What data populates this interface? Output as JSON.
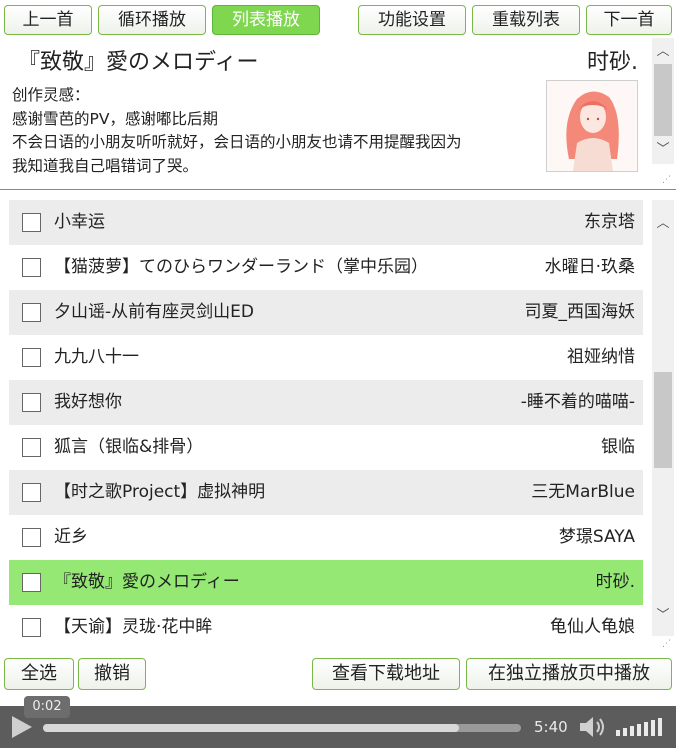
{
  "toolbar": {
    "prev": "上一首",
    "loop": "循环播放",
    "list_play": "列表播放",
    "settings": "功能设置",
    "reload": "重载列表",
    "next": "下一首"
  },
  "now_playing": {
    "title": "『致敬』愛のメロディー",
    "artist": "时砂.",
    "description": [
      "创作灵感：",
      "感谢雪芭的PV，感谢嘟比后期",
      "不会日语的小朋友听听就好，会日语的小朋友也请不用提醒我因为",
      "我知道我自己唱错词了哭。"
    ]
  },
  "playlist": [
    {
      "title": "小幸运",
      "artist": "东京塔"
    },
    {
      "title": "【猫菠萝】てのひらワンダーランド（掌中乐园）",
      "artist": "水曜日·玖桑"
    },
    {
      "title": "夕山谣-从前有座灵剑山ED",
      "artist": "司夏_西国海妖"
    },
    {
      "title": "九九八十一",
      "artist": "祖娅纳惜"
    },
    {
      "title": "我好想你",
      "artist": "-睡不着的喵喵-"
    },
    {
      "title": "狐言（银临&排骨）",
      "artist": "银临"
    },
    {
      "title": "【时之歌Project】虚拟神明",
      "artist": "三无MarBlue"
    },
    {
      "title": "近乡",
      "artist": "梦璟SAYA"
    },
    {
      "title": "『致敬』愛のメロディー",
      "artist": "时砂."
    },
    {
      "title": "【天谕】灵珑·花中眸",
      "artist": "龟仙人龟娘"
    }
  ],
  "bottom_bar": {
    "select_all": "全选",
    "cancel": "撤销",
    "download": "查看下载地址",
    "standalone": "在独立播放页中播放"
  },
  "player": {
    "current_time": "0:02",
    "duration": "5:40",
    "progress": 0.87
  },
  "colors": {
    "accent": "#7fd64f",
    "playing_row": "#94e873",
    "shade_row": "#ececec",
    "player_bg": "#5c5c5c"
  }
}
